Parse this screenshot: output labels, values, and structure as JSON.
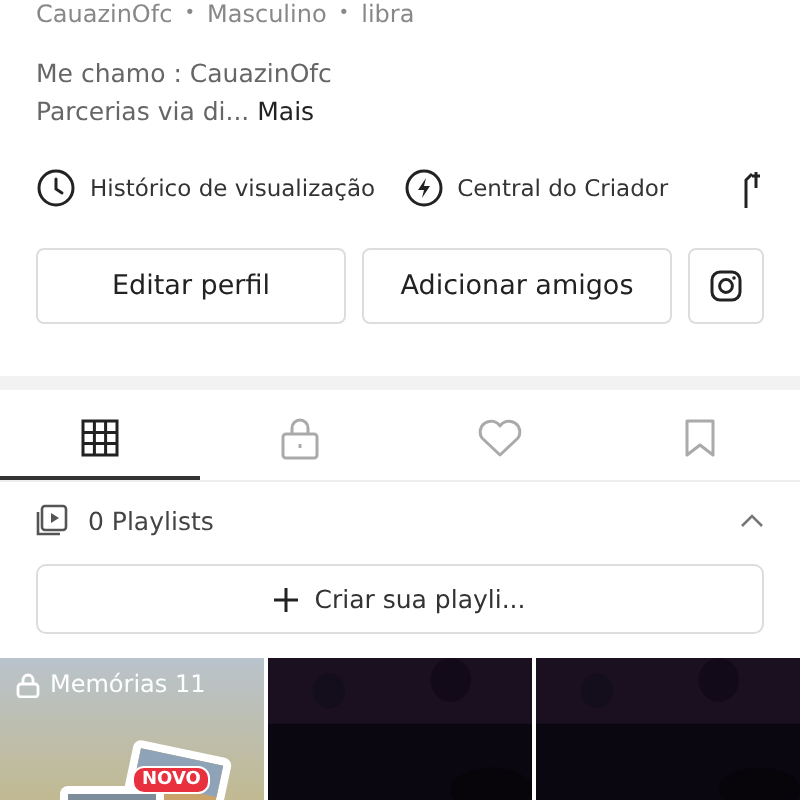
{
  "profile_info": [
    {
      "kind": "text",
      "text": "CauazinOfc"
    },
    {
      "kind": "separator",
      "text": "•"
    },
    {
      "kind": "text",
      "text": "Masculino"
    },
    {
      "kind": "separator",
      "text": "•"
    },
    {
      "kind": "text",
      "text": "libra"
    }
  ],
  "bio": {
    "line_1": "Me chamo : CauazinOfc",
    "line_2": "Parcerias via di...",
    "more_link": "Mais"
  },
  "shortcuts": [
    {
      "kind": "history",
      "label": "Histórico de visualização"
    },
    {
      "kind": "creator",
      "label": "Central do Criador"
    },
    {
      "kind": "partial"
    }
  ],
  "buttons": [
    {
      "kind": "text",
      "label": "Editar perfil"
    },
    {
      "kind": "text",
      "label": "Adicionar amigos"
    },
    {
      "kind": "instagram"
    }
  ],
  "tabs": [
    {
      "kind": "grid",
      "selected": true
    },
    {
      "kind": "lock",
      "selected": false
    },
    {
      "kind": "heart",
      "selected": false
    },
    {
      "kind": "bookmark",
      "selected": false
    }
  ],
  "playlists": {
    "count_label": "0 Playlists",
    "expanded": true,
    "create_button": "Criar sua playli..."
  },
  "grid": [
    {
      "kind": "memories",
      "label": "Memórias 11",
      "badge": "NOVO"
    },
    {
      "kind": "video"
    },
    {
      "kind": "video"
    }
  ]
}
